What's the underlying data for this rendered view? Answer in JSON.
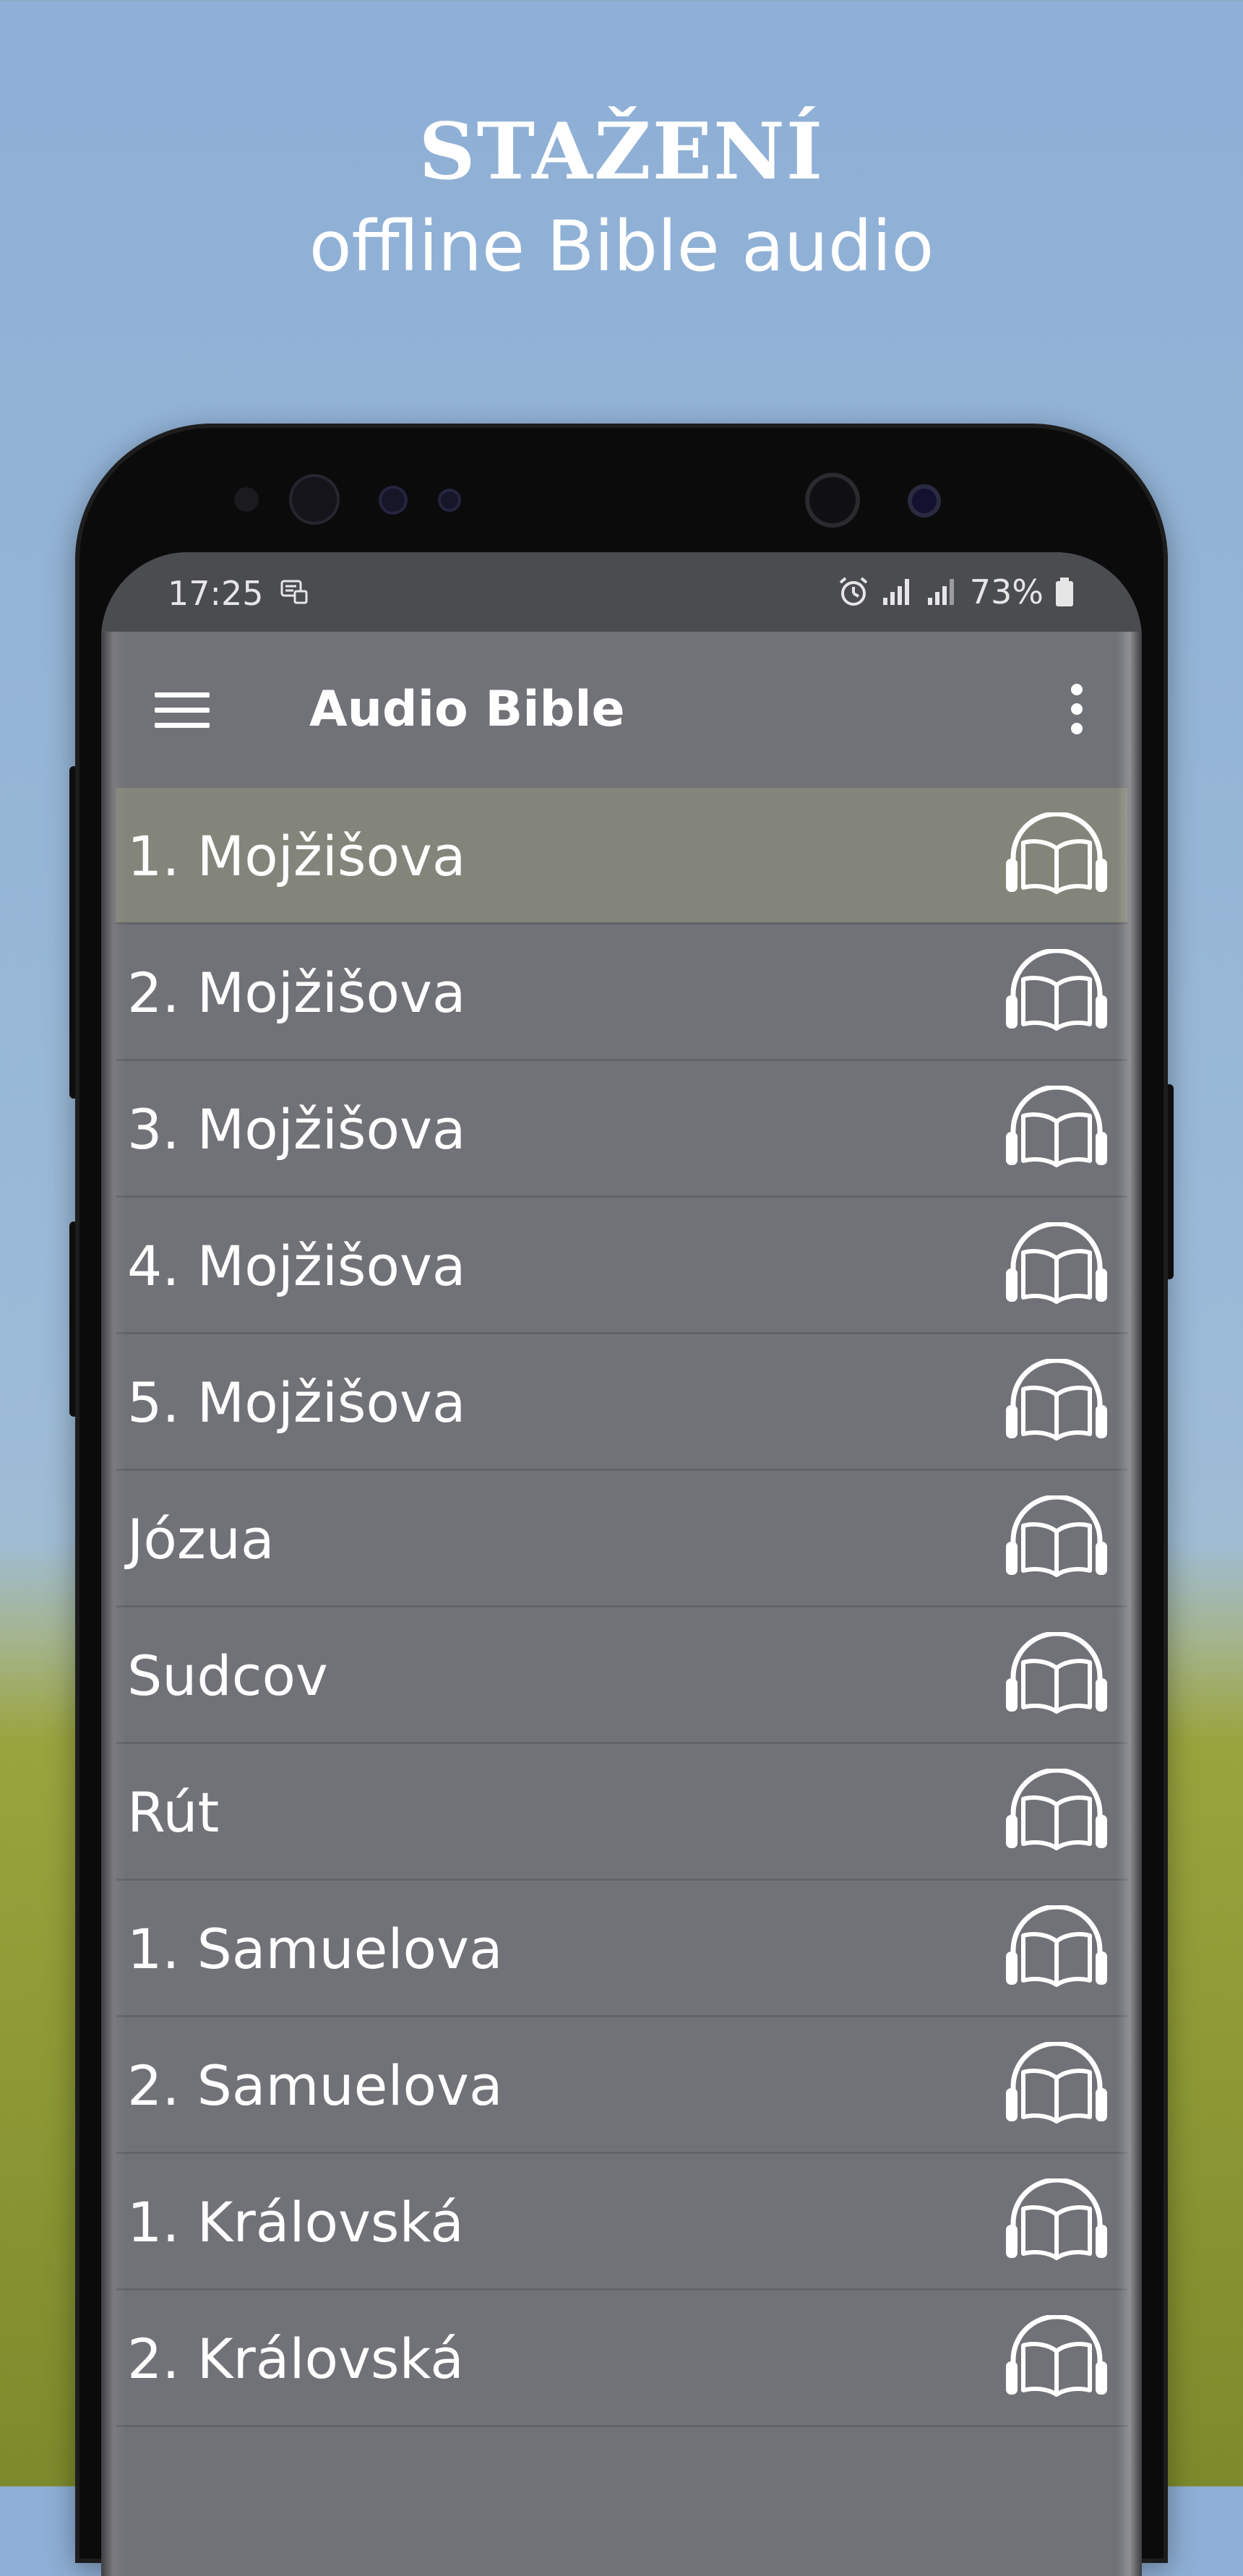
{
  "promo": {
    "title": "STAŽENÍ",
    "subtitle": "offline Bible audio"
  },
  "status_bar": {
    "time": "17:25",
    "battery": "73%"
  },
  "app_bar": {
    "title": "Audio Bible"
  },
  "books": [
    {
      "label": "1. Mojžišova",
      "selected": true
    },
    {
      "label": "2. Mojžišova",
      "selected": false
    },
    {
      "label": "3. Mojžišova",
      "selected": false
    },
    {
      "label": "4. Mojžišova",
      "selected": false
    },
    {
      "label": "5. Mojžišova",
      "selected": false
    },
    {
      "label": "Józua",
      "selected": false
    },
    {
      "label": "Sudcov",
      "selected": false
    },
    {
      "label": "Rút",
      "selected": false
    },
    {
      "label": "1. Samuelova",
      "selected": false
    },
    {
      "label": "2. Samuelova",
      "selected": false
    },
    {
      "label": "1. Královská",
      "selected": false
    },
    {
      "label": "2. Královská",
      "selected": false
    }
  ],
  "icons": {
    "item": "audio-book-icon",
    "menu": "hamburger-menu-icon",
    "more": "more-vertical-icon"
  },
  "colors": {
    "app_bar": "#717278",
    "status_bar": "#4a4c50",
    "selected_row": "#84857a",
    "text": "#ffffff"
  }
}
